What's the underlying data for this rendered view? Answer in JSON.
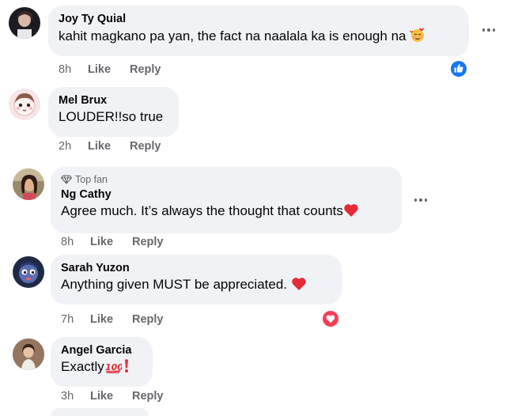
{
  "comments": [
    {
      "author": "Joy Ty Quial",
      "text": "kahit magkano pa yan, the fact na naalala ka is enough na",
      "emoji": "smiling-face-with-hearts",
      "time": "8h",
      "like": "Like",
      "reply": "Reply",
      "reaction": "like",
      "has_more": true
    },
    {
      "author": "Mel Brux",
      "text": "LOUDER!!so true",
      "time": "2h",
      "like": "Like",
      "reply": "Reply"
    },
    {
      "badge": "Top fan",
      "author": "Ng Cathy",
      "text": "Agree much. It’s always the thought that counts",
      "emoji": "red-heart",
      "time": "8h",
      "like": "Like",
      "reply": "Reply",
      "has_more": true
    },
    {
      "author": "Sarah Yuzon",
      "text": "Anything given MUST be appreciated. ",
      "emoji": "red-heart",
      "time": "7h",
      "like": "Like",
      "reply": "Reply",
      "reaction": "love"
    },
    {
      "author": "Angel Garcia",
      "text": "Exactly",
      "emoji": "hundred-points-exclamation",
      "time": "3h",
      "like": "Like",
      "reply": "Reply"
    }
  ],
  "colors": {
    "bubble": "#f0f2f5",
    "meta_text": "#65676b",
    "like_blue": "#1877f2",
    "love_red": "#f33e58"
  }
}
